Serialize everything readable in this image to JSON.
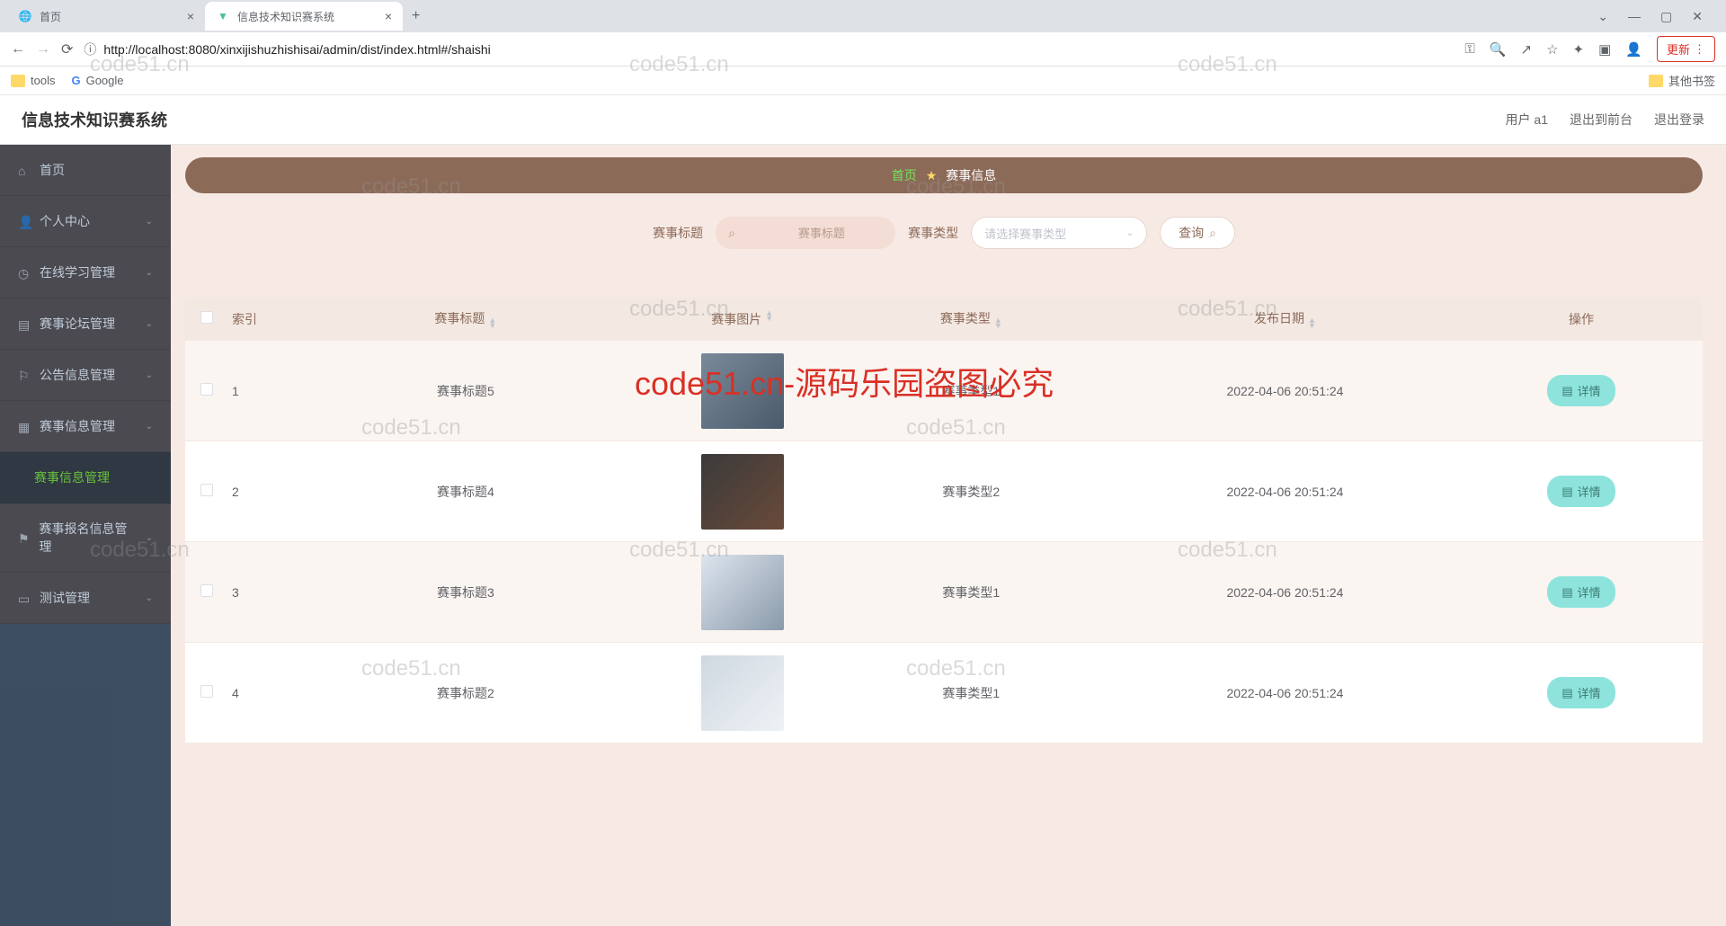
{
  "browser": {
    "tabs": [
      {
        "title": "首页",
        "active": false
      },
      {
        "title": "信息技术知识赛系统",
        "active": true
      }
    ],
    "url": "http://localhost:8080/xinxijishuzhishisai/admin/dist/index.html#/shaishi",
    "update_label": "更新",
    "bookmarks": {
      "tools": "tools",
      "google": "Google",
      "other": "其他书签"
    }
  },
  "header": {
    "title": "信息技术知识赛系统",
    "user": "用户 a1",
    "front": "退出到前台",
    "logout": "退出登录"
  },
  "sidebar": {
    "items": [
      "首页",
      "个人中心",
      "在线学习管理",
      "赛事论坛管理",
      "公告信息管理",
      "赛事信息管理",
      "赛事信息管理",
      "赛事报名信息管理",
      "测试管理"
    ]
  },
  "breadcrumb": {
    "home": "首页",
    "current": "赛事信息"
  },
  "search": {
    "title_label": "赛事标题",
    "title_placeholder": "赛事标题",
    "type_label": "赛事类型",
    "type_placeholder": "请选择赛事类型",
    "query": "查询"
  },
  "table": {
    "cols": {
      "idx": "索引",
      "title": "赛事标题",
      "img": "赛事图片",
      "type": "赛事类型",
      "date": "发布日期",
      "act": "操作"
    },
    "detail_label": "详情",
    "rows": [
      {
        "idx": "1",
        "title": "赛事标题5",
        "type": "赛事类型1",
        "date": "2022-04-06 20:51:24"
      },
      {
        "idx": "2",
        "title": "赛事标题4",
        "type": "赛事类型2",
        "date": "2022-04-06 20:51:24"
      },
      {
        "idx": "3",
        "title": "赛事标题3",
        "type": "赛事类型1",
        "date": "2022-04-06 20:51:24"
      },
      {
        "idx": "4",
        "title": "赛事标题2",
        "type": "赛事类型1",
        "date": "2022-04-06 20:51:24"
      }
    ]
  },
  "watermark": "code51.cn",
  "big_watermark": "code51.cn-源码乐园盗图必究"
}
